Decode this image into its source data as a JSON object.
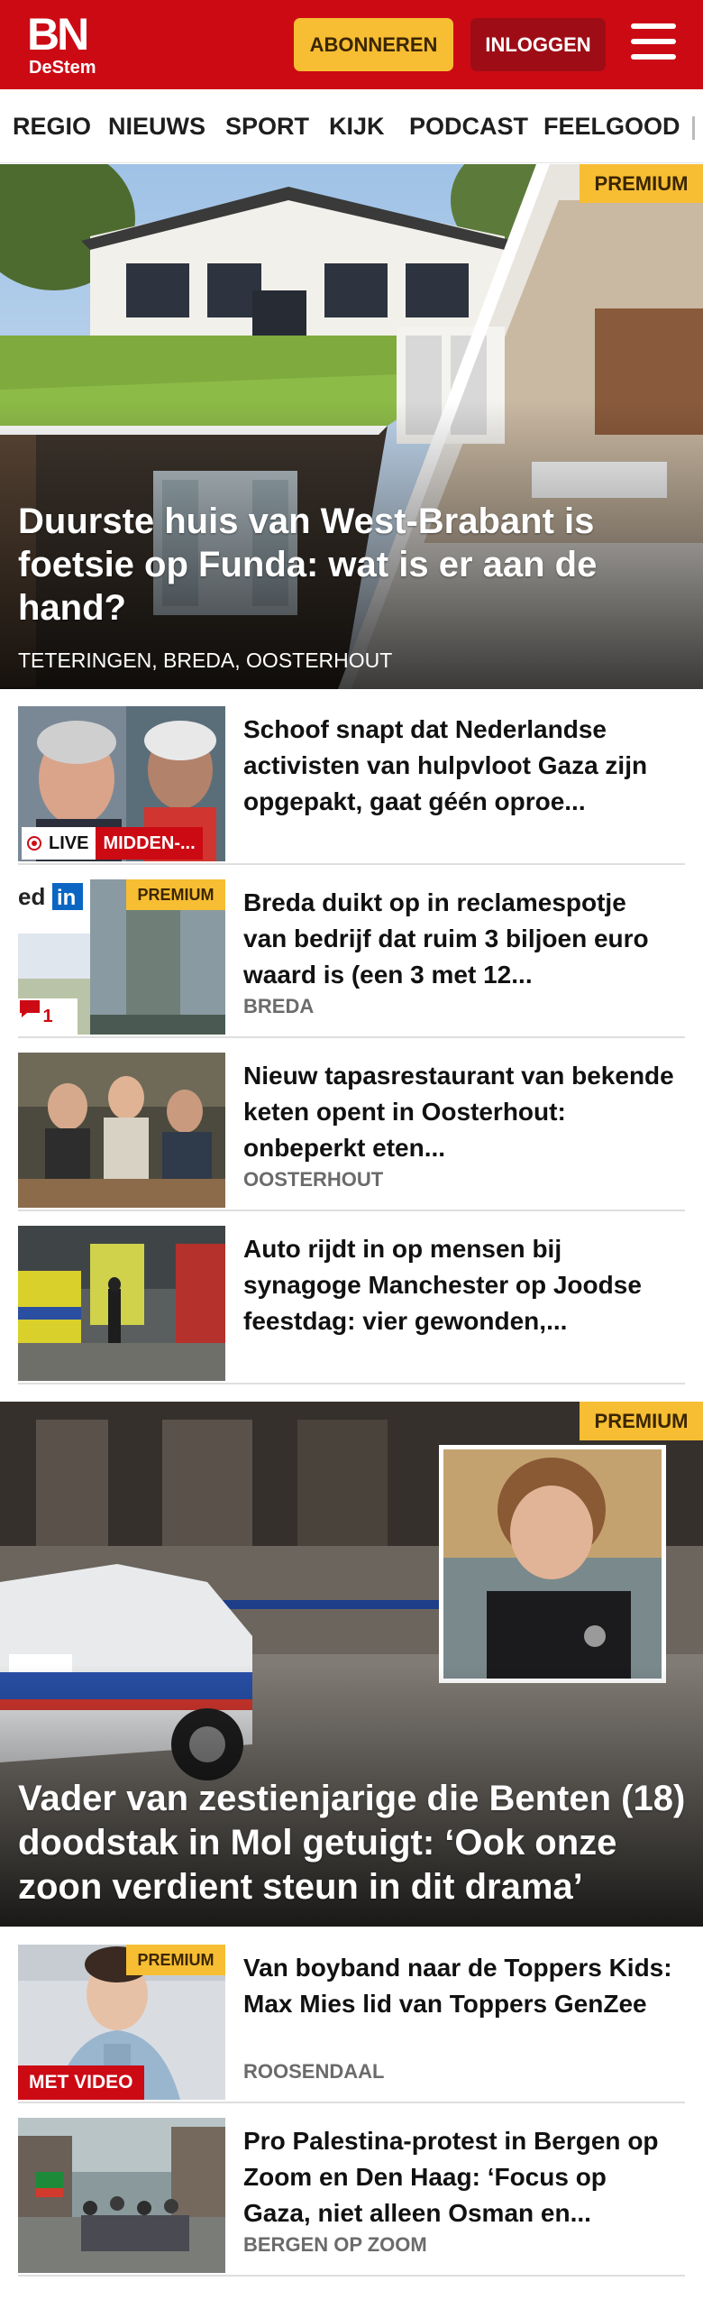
{
  "header": {
    "logo_main": "BN",
    "logo_sub": "DeStem",
    "subscribe_label": "ABONNEREN",
    "login_label": "INLOGGEN",
    "brand_color": "#cc0a14",
    "accent_color": "#f7be33"
  },
  "nav": {
    "items": [
      "REGIO",
      "NIEUWS",
      "SPORT",
      "KIJK",
      "PODCAST",
      "FEELGOOD"
    ]
  },
  "premium_label": "PREMIUM",
  "hero": {
    "title": "Duurste huis van West-Brabant is foetsie op Funda: wat is er aan de hand?",
    "tags": "TETERINGEN, BREDA, OOSTERHOUT"
  },
  "articles": [
    {
      "title": "Schoof snapt dat Nederlandse activisten van hulpvloot Gaza zijn opgepakt, gaat géén oproe...",
      "live_label": "LIVE",
      "live_topic": "MIDDEN-..."
    },
    {
      "title": "Breda duikt op in reclamespotje van bedrijf dat ruim 3 biljoen euro waard is (een 3 met 12...",
      "region": "BREDA",
      "comments": "1"
    },
    {
      "title": "Nieuw tapasrestaurant van bekende keten opent in Oosterhout: onbeperkt eten...",
      "region": "OOSTERHOUT"
    },
    {
      "title": "Auto rijdt in op mensen bij synagoge Manchester op Joodse feestdag: vier gewonden,..."
    }
  ],
  "hero2": {
    "title": "Vader van zestienjarige die Benten (18) doodstak in Mol getuigt: ‘Ook onze zoon verdient steun in dit drama’"
  },
  "articles2": [
    {
      "title": "Van boyband naar de Toppers Kids: Max Mies lid van Toppers GenZee",
      "region": "ROOSENDAAL",
      "video_label": "MET VIDEO"
    },
    {
      "title": "Pro Palestina-protest in Bergen op Zoom en Den Haag: ‘Focus op Gaza, niet alleen Osman en...",
      "region": "BERGEN OP ZOOM"
    }
  ]
}
